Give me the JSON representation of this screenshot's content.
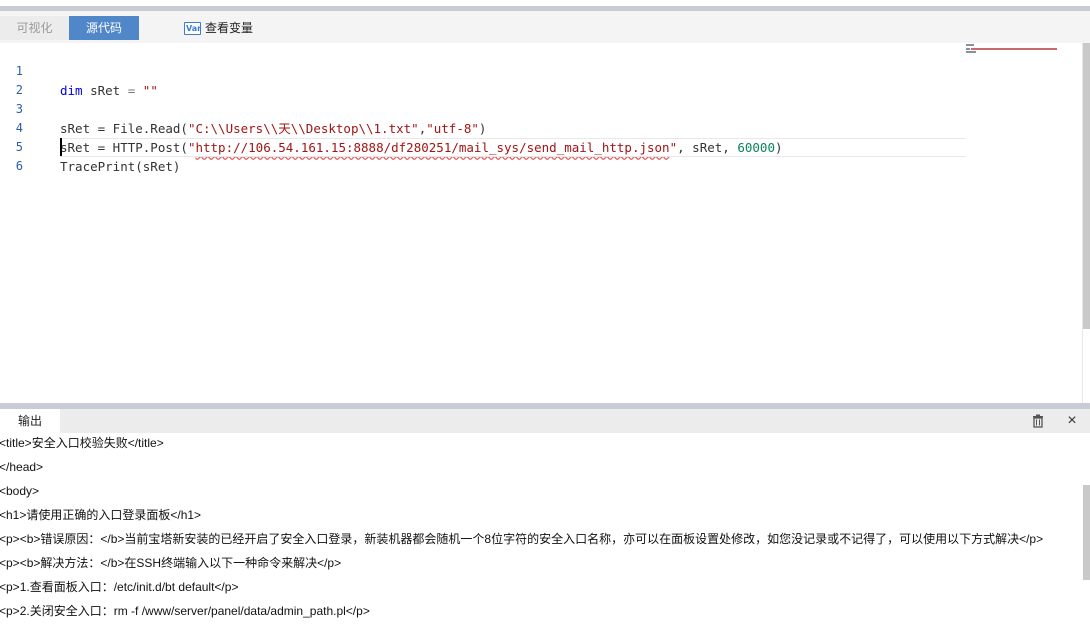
{
  "tabs": {
    "visual": "可视化",
    "source": "源代码",
    "view_vars": "查看变量"
  },
  "editor": {
    "line_numbers": [
      "1",
      "2",
      "3",
      "4",
      "5",
      "6"
    ],
    "line1": {
      "kw": "dim",
      "var": " sRet ",
      "eq": "=",
      "str": " \"\""
    },
    "line3": {
      "pre": "sRet = File.Read(",
      "s1": "\"C:\\\\Users\\\\天\\\\Desktop\\\\1.txt\"",
      "comma": ",",
      "s2": "\"utf-8\"",
      "post": ")"
    },
    "line4": {
      "pre": "sRet = HTTP.Post(",
      "q1": "\"",
      "url": "http://106.54.161.15:8888/df280251/mail_sys/send_mail_http.json",
      "q2": "\"",
      "mid": ", sRet, ",
      "num": "60000",
      "post": ")"
    },
    "line5": "TracePrint(sRet)"
  },
  "output": {
    "tab": "输出",
    "close": "×",
    "lines": [
      "<title>安全入口校验失败</title>",
      "</head>",
      "<body>",
      "<h1>请使用正确的入口登录面板</h1>",
      "<p><b>错误原因：</b>当前宝塔新安装的已经开启了安全入口登录，新装机器都会随机一个8位字符的安全入口名称，亦可以在面板设置处修改，如您没记录或不记得了，可以使用以下方式解决</p>",
      "<p><b>解决方法：</b>在SSH终端输入以下一种命令来解决</p>",
      "<p>1.查看面板入口：/etc/init.d/bt default</p>",
      "<p>2.关闭安全入口：rm -f /www/server/panel/data/admin_path.pl</p>"
    ]
  },
  "colors": {
    "accent": "#4f87c8",
    "keyword": "#0000e0",
    "string": "#a31515",
    "number": "#098658"
  }
}
